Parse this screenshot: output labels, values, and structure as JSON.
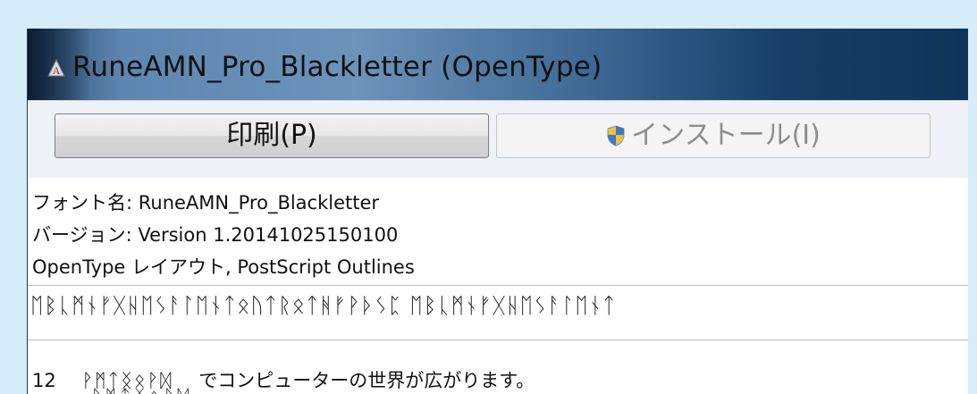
{
  "window": {
    "title": "RuneAMN_Pro_Blackletter (OpenType)"
  },
  "toolbar": {
    "print_label": "印刷(P)",
    "install_label": "インストール(I)"
  },
  "info": {
    "font_name": "フォント名: RuneAMN_Pro_Blackletter",
    "version": "バージョン: Version 1.20141025150100",
    "format": "OpenType レイアウト, PostScript Outlines"
  },
  "sample": {
    "alphabet": "ᛖᛒᚳᛗᚾᚠᚷᚺᛖᛊᚨᛚᛖᚾᛏᛟᚢᛏᚱᛟᛏᚻᚠᚹᚦᛊᛈ  ᛖᛒᚳᛗᚾᚠᚷᚺᛖᛊᚨᛚᛖᚾᛏ",
    "size": "12",
    "glyphs": "ᚹᛗᛏᛝᛟᚹᛞ",
    "text": "でコンピューターの世界が広がります。",
    "next_line": "ᚹᛗᛏᛝᛟᚹᛞ"
  },
  "colors": {
    "background": "#d6ecf8",
    "titlebar_accent": "#5d86b0"
  },
  "icons": {
    "title": "font-app-icon",
    "install": "uac-shield-icon"
  }
}
